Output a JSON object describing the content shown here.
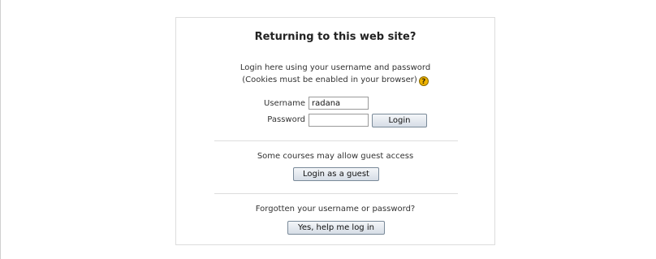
{
  "login": {
    "title": "Returning to this web site?",
    "intro_line1": "Login here using your username and password",
    "intro_line2": "(Cookies must be enabled in your browser)",
    "help_icon": "help-question-icon",
    "username_label": "Username",
    "username_value": "radana",
    "password_label": "Password",
    "password_value": "",
    "login_button": "Login"
  },
  "guest": {
    "text": "Some courses may allow guest access",
    "button": "Login as a guest"
  },
  "forgot": {
    "text": "Forgotten your username or password?",
    "button": "Yes, help me log in"
  },
  "colors": {
    "help_icon": "#f0b400",
    "border": "#dddddd"
  }
}
